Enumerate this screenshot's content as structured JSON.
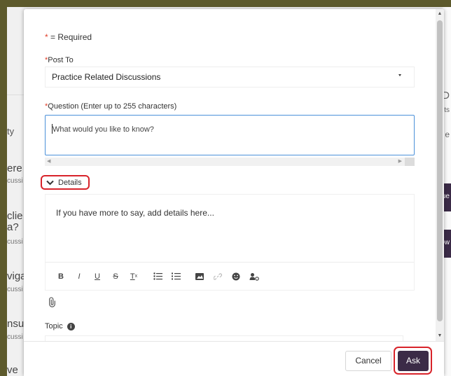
{
  "background": {
    "left_fragments": [
      "ty",
      "ere",
      "cussi",
      "clie",
      "a?",
      "cussi",
      "viga",
      "cussi",
      "nsu",
      "cussi",
      "ve"
    ],
    "right_fragments": [
      "D",
      "ts",
      "e",
      "ue",
      "ow"
    ]
  },
  "modal": {
    "required_star": "*",
    "required_note": " = Required",
    "post_to": {
      "label": "Post To",
      "value": "Practice Related Discussions"
    },
    "question": {
      "label": "Question (Enter up to 255 characters)",
      "placeholder": "What would you like to know?"
    },
    "details": {
      "toggle_label": "Details",
      "placeholder": "If you have more to say, add details here..."
    },
    "toolbar": {
      "bold": "B",
      "italic": "I",
      "underline": "U",
      "strike": "S",
      "clear_format": "T",
      "clear_sub": "x"
    },
    "topic": {
      "label": "Topic",
      "info": "i"
    }
  },
  "footer": {
    "cancel_label": "Cancel",
    "ask_label": "Ask"
  },
  "colors": {
    "accent": "#3b2b47",
    "highlight_ring": "#d8232a",
    "required": "#e0402b",
    "focus_border": "#4a90d9"
  },
  "icons": [
    "chevron-down-icon",
    "bullet-list-icon",
    "numbered-list-icon",
    "image-icon",
    "link-icon",
    "emoji-icon",
    "mention-icon",
    "attachment-icon",
    "info-icon",
    "dropdown-caret-icon"
  ]
}
